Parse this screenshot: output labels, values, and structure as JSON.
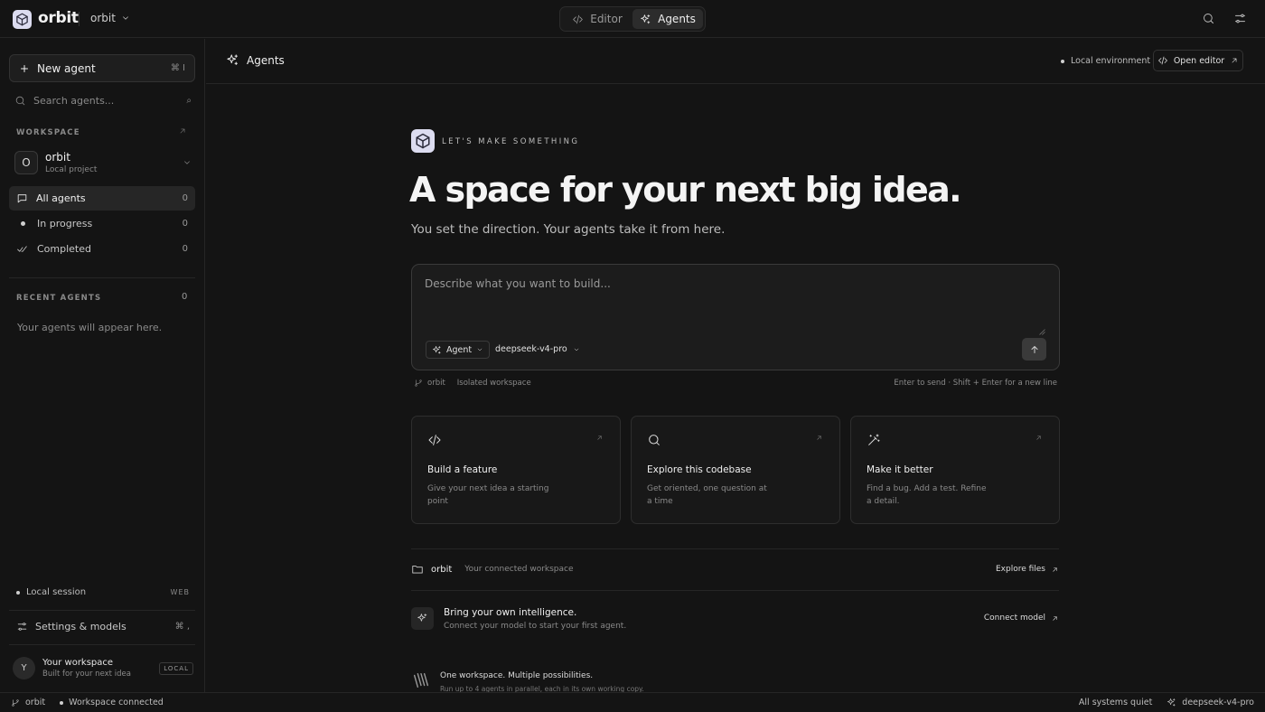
{
  "app": {
    "brand": "orbit",
    "project_selector": "orbit"
  },
  "top_tabs": [
    {
      "label": "Editor",
      "icon": "code-icon"
    },
    {
      "label": "Agents",
      "icon": "sparkle-icon",
      "active": true
    }
  ],
  "sidebar": {
    "new_agent_label": "New agent",
    "new_agent_shortcut": "⌘ I",
    "search_placeholder": "Search agents...",
    "search_shortcut": "⌕",
    "workspace_label": "WORKSPACE",
    "project": {
      "initial": "O",
      "name": "orbit",
      "subtitle": "Local project"
    },
    "nav": [
      {
        "label": "All agents",
        "count": "0",
        "icon": "chat-icon"
      },
      {
        "label": "In progress",
        "count": "0",
        "icon": "dot-icon"
      },
      {
        "label": "Completed",
        "count": "0",
        "icon": "check-icon"
      }
    ],
    "recent_label": "RECENT AGENTS",
    "recent_count": "0",
    "empty_hint": "Your agents will appear here.",
    "session_label": "Local session",
    "session_badge": "WEB",
    "settings_label": "Settings & models",
    "settings_shortcut": "⌘ ,",
    "user": {
      "initial": "Y",
      "name": "Your workspace",
      "subtitle": "Built for your next idea",
      "badge": "LOCAL"
    }
  },
  "main": {
    "title": "Agents",
    "env_label": "Local environment",
    "open_editor_label": "Open editor",
    "eyebrow": "LET'S MAKE SOMETHING",
    "headline": "A space for your next big idea.",
    "subline": "You set the direction. Your agents take it from here.",
    "composer": {
      "placeholder": "Describe what you want to build...",
      "mode_label": "Agent",
      "model_label": "deepseek-v4-pro",
      "branch_label": "orbit",
      "workspace_label": "Isolated workspace",
      "hint": "Enter to send · Shift + Enter for a new line"
    },
    "cards": [
      {
        "title": "Build a feature",
        "desc": "Give your next idea a starting point",
        "icon": "code-icon"
      },
      {
        "title": "Explore this codebase",
        "desc": "Get oriented, one question at a time",
        "icon": "search-icon"
      },
      {
        "title": "Make it better",
        "desc": "Find a bug. Add a test. Refine a detail.",
        "icon": "magic-wand-icon"
      }
    ],
    "workspace_row": {
      "name": "orbit",
      "desc": "Your connected workspace",
      "action": "Explore files"
    },
    "model_row": {
      "title": "Bring your own intelligence.",
      "desc": "Connect your model to start your first agent.",
      "action": "Connect model"
    },
    "multi_row": {
      "title": "One workspace. Multiple possibilities.",
      "desc": "Run up to 4 agents in parallel, each in its own working copy."
    }
  },
  "statusbar": {
    "branch": "orbit",
    "connection": "Workspace connected",
    "systems": "All systems quiet",
    "model": "deepseek-v4-pro"
  }
}
